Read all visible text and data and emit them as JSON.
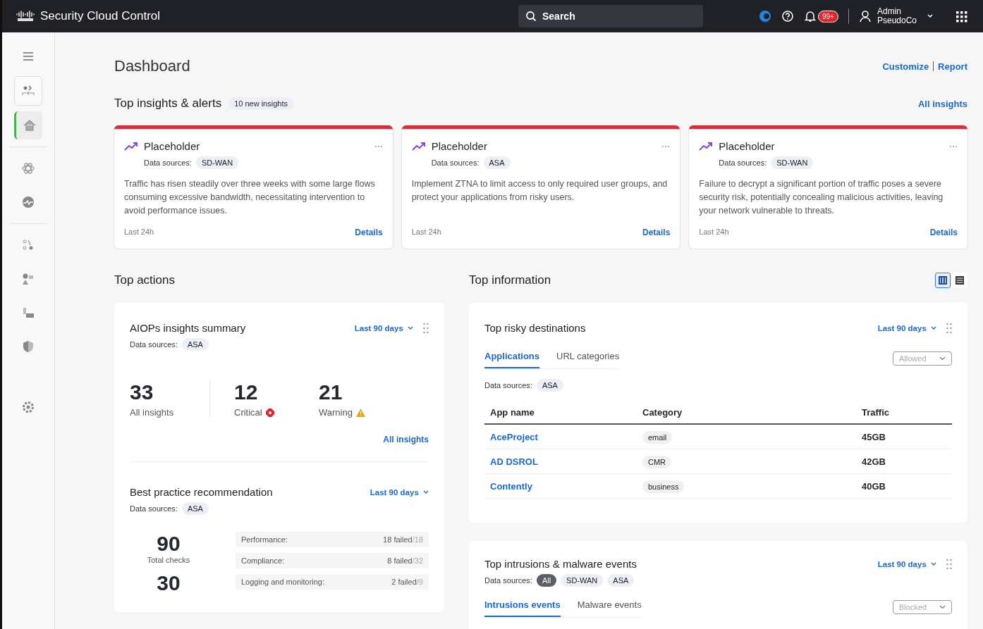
{
  "header": {
    "brand": "Security Cloud Control",
    "search": {
      "placeholder": "Search"
    },
    "notifications": "99+",
    "user": {
      "name": "Admin",
      "org": "PseudoCo"
    }
  },
  "sidebar": {
    "items": [
      {
        "selected": false
      },
      {
        "selected": false
      },
      {
        "selected": true
      },
      {
        "selected": false
      },
      {
        "selected": false
      },
      {
        "selected": false
      },
      {
        "selected": false
      },
      {
        "selected": false
      },
      {
        "selected": false
      },
      {
        "selected": false
      }
    ]
  },
  "page": {
    "title": "Dashboard",
    "links": [
      "Customize",
      "Report"
    ]
  },
  "insights": {
    "title": "Top insights & alerts",
    "badge": "10 new insights",
    "link": "All insights",
    "cards": [
      {
        "title": "Placeholder",
        "sources_label": "Data sources:",
        "sources": [
          "SD-WAN"
        ],
        "text": "Traffic has risen steadily over three weeks with some large flows consuming excessive bandwidth, necessitating intervention to avoid performance issues.",
        "time": "Last 24h",
        "action": "Details"
      },
      {
        "title": "Placeholder",
        "sources_label": "Data sources:",
        "sources": [
          "ASA"
        ],
        "text": "Implement ZTNA to limit access to only required user groups, and protect your applications from risky users.",
        "time": "Last 24h",
        "action": "Details"
      },
      {
        "title": "Placeholder",
        "sources_label": "Data sources:",
        "sources": [
          "SD-WAN"
        ],
        "text": "Failure to decrypt a significant portion of traffic poses a severe security risk, potentially concealing malicious activities, leaving your network vulnerable to threats.",
        "time": "Last 24h",
        "action": "Details"
      }
    ]
  },
  "top_actions": {
    "title": "Top actions",
    "aiops": {
      "title": "AIOPs insights summary",
      "range": "Last 90 days",
      "sources_label": "Data sources:",
      "sources": [
        "ASA"
      ],
      "stats": [
        {
          "kind": "total",
          "value": "33",
          "label": "All insights"
        },
        {
          "kind": "critical",
          "value": "12",
          "label": "Critical"
        },
        {
          "kind": "warning",
          "value": "21",
          "label": "Warning"
        }
      ],
      "link": "All insights"
    },
    "best_practice": {
      "title": "Best practice recommendation",
      "range": "Last 90 days",
      "sources_label": "Data sources:",
      "sources": [
        "ASA"
      ],
      "totals": [
        {
          "value": "90",
          "label": "Total checks"
        },
        {
          "value": "30"
        }
      ],
      "rows": [
        {
          "label": "Performance:",
          "failed": "18 failed",
          "total": "/18"
        },
        {
          "label": "Compliance:",
          "failed": "8 failed",
          "total": "/32"
        },
        {
          "label": "Logging and monitoring:",
          "failed": "2 failed",
          "total": "/9"
        }
      ]
    }
  },
  "top_information": {
    "title": "Top information",
    "views": [
      {
        "selected": true
      },
      {
        "selected": false
      }
    ],
    "risky": {
      "title": "Top risky destinations",
      "range": "Last 90 days",
      "tabs": [
        {
          "label": "Applications",
          "selected": true
        },
        {
          "label": "URL categories",
          "selected": false
        }
      ],
      "filter": "Allowed",
      "sources_label": "Data sources:",
      "sources": [
        {
          "label": "ASA",
          "selected": false
        }
      ],
      "table": {
        "columns": [
          "App name",
          "Category",
          "Traffic"
        ],
        "rows": [
          {
            "app": "AceProject",
            "category": "email",
            "traffic": "45GB"
          },
          {
            "app": "AD DSROL",
            "category": "CMR",
            "traffic": "42GB"
          },
          {
            "app": "Contently",
            "category": "business",
            "traffic": "40GB"
          }
        ]
      }
    },
    "intrusions": {
      "title": "Top intrusions & malware events",
      "range": "Last 90 days",
      "sources_label": "Data sources:",
      "sources": [
        {
          "label": "All",
          "selected": true
        },
        {
          "label": "SD-WAN",
          "selected": false
        },
        {
          "label": "ASA",
          "selected": false
        }
      ],
      "tabs": [
        {
          "label": "Intrusions events",
          "selected": true
        },
        {
          "label": "Malware events",
          "selected": false
        }
      ],
      "filter": "Blocked"
    }
  }
}
